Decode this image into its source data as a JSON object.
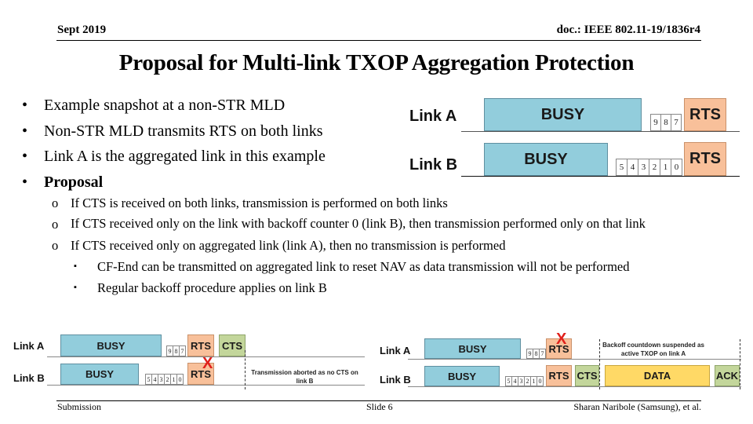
{
  "header": {
    "date": "Sept 2019",
    "doc_id": "doc.: IEEE 802.11-19/1836r4"
  },
  "title": "Proposal for Multi-link TXOP Aggregation Protection",
  "bullets": [
    {
      "marker": "•",
      "text": "Example snapshot at a non-STR MLD",
      "bold": false
    },
    {
      "marker": "•",
      "text": "Non-STR MLD transmits RTS on both links",
      "bold": false
    },
    {
      "marker": "•",
      "text": "Link A is the aggregated link in this example",
      "bold": false
    },
    {
      "marker": "•",
      "text": "Proposal",
      "bold": true
    }
  ],
  "sub_bullets": [
    {
      "marker": "o",
      "level": 1,
      "text": "If CTS is received on both links, transmission is performed on both links"
    },
    {
      "marker": "o",
      "level": 1,
      "text": "If CTS received only on the link with backoff counter 0 (link B), then transmission performed only on that link"
    },
    {
      "marker": "o",
      "level": 1,
      "text": "If CTS received only on aggregated link (link A), then no transmission is performed"
    },
    {
      "marker": "▪",
      "level": 2,
      "text": "CF-End can be transmitted on aggregated link to reset NAV as data transmission will not be performed"
    },
    {
      "marker": "▪",
      "level": 2,
      "text": "Regular backoff procedure applies on link B"
    }
  ],
  "diagram_top": {
    "link_a": {
      "label": "Link A",
      "busy": "BUSY",
      "counter": [
        "9",
        "8",
        "7"
      ],
      "frame": "RTS"
    },
    "link_b": {
      "label": "Link B",
      "busy": "BUSY",
      "counter": [
        "5",
        "4",
        "3",
        "2",
        "1",
        "0"
      ],
      "frame": "RTS"
    }
  },
  "diagram_left": {
    "link_a": {
      "label": "Link A",
      "busy": "BUSY",
      "counter": [
        "9",
        "8",
        "7"
      ],
      "frame": "RTS",
      "response": "CTS"
    },
    "link_b": {
      "label": "Link B",
      "busy": "BUSY",
      "counter": [
        "5",
        "4",
        "3",
        "2",
        "1",
        "0"
      ],
      "frame": "RTS",
      "failed_mark": "X"
    },
    "note": "Transmission aborted as no CTS on link B"
  },
  "diagram_right": {
    "link_a": {
      "label": "Link A",
      "busy": "BUSY",
      "counter": [
        "9",
        "8",
        "7"
      ],
      "frame": "RTS",
      "failed_mark": "X"
    },
    "link_b": {
      "label": "Link B",
      "busy": "BUSY",
      "counter": [
        "5",
        "4",
        "3",
        "2",
        "1",
        "0"
      ],
      "frame": "RTS",
      "response": "CTS",
      "data": "DATA",
      "ack": "ACK"
    },
    "note": "Backoff countdown suspended as active TXOP on link A"
  },
  "colors": {
    "busy": "#92cddc",
    "rts": "#f8c09a",
    "cts": "#c3d69b",
    "data": "#ffd966",
    "x_mark": "#e0201b"
  },
  "footer": {
    "left": "Submission",
    "center": "Slide 6",
    "right": "Sharan Naribole (Samsung), et al."
  }
}
